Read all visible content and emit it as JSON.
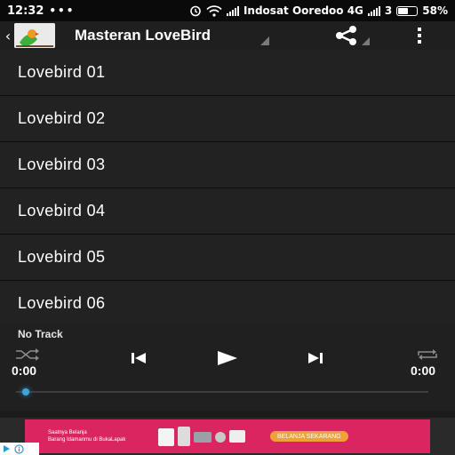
{
  "status_bar": {
    "time": "12:32",
    "carrier": "Indosat Ooredoo 4G",
    "sim_slot": "3",
    "battery": "58%",
    "battery_level": 0.58,
    "icons": [
      "more-dots-icon",
      "alarm-icon",
      "wifi-icon",
      "signal-icon",
      "signal-icon",
      "battery-icon"
    ]
  },
  "app_bar": {
    "title": "Masteran LoveBird",
    "icons": [
      "back-icon",
      "lovebird-logo",
      "share-icon",
      "overflow-menu-icon"
    ]
  },
  "tracks": [
    "Lovebird 01",
    "Lovebird 02",
    "Lovebird 03",
    "Lovebird 04",
    "Lovebird 05",
    "Lovebird 06"
  ],
  "player": {
    "now_playing": "No Track",
    "elapsed": "0:00",
    "duration": "0:00",
    "progress": 0,
    "icons": [
      "shuffle-icon",
      "previous-icon",
      "play-icon",
      "next-icon",
      "repeat-icon"
    ]
  },
  "ad": {
    "line1": "Saatnya Belanja",
    "line2": "Barang Idamanmu di BukaLapak",
    "cta": "BELANJA SEKARANG",
    "colors": {
      "background": "#d92560",
      "cta": "#f2a13a"
    }
  },
  "colors": {
    "accent": "#3aa7d8",
    "background": "#222222",
    "status_bar": "#0a0a0a"
  }
}
